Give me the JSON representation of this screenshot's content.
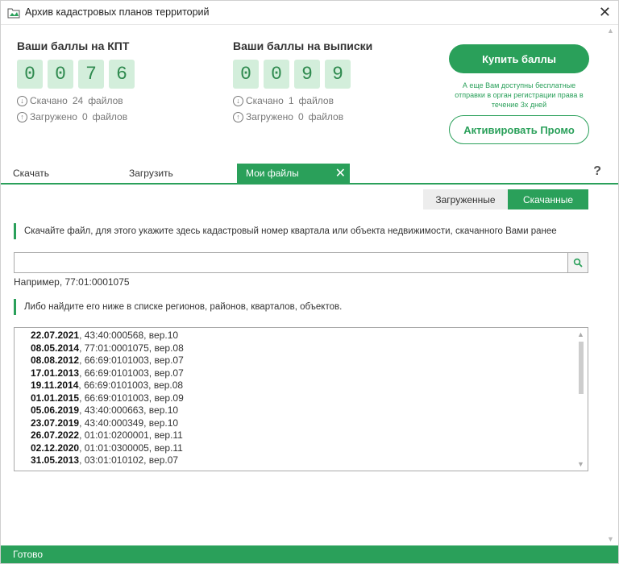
{
  "window": {
    "title": "Архив кадастровых планов территорий"
  },
  "kpt": {
    "title": "Ваши баллы на КПТ",
    "digits": [
      "0",
      "0",
      "7",
      "6"
    ],
    "downloaded_label": "Скачано",
    "downloaded_count": "24",
    "downloaded_unit": "файлов",
    "uploaded_label": "Загружено",
    "uploaded_count": "0",
    "uploaded_unit": "файлов"
  },
  "extracts": {
    "title": "Ваши баллы на выписки",
    "digits": [
      "0",
      "0",
      "9",
      "9"
    ],
    "downloaded_label": "Скачано",
    "downloaded_count": "1",
    "downloaded_unit": "файлов",
    "uploaded_label": "Загружено",
    "uploaded_count": "0",
    "uploaded_unit": "файлов"
  },
  "actions": {
    "buy_label": "Купить баллы",
    "promo_note": "А еще Вам доступны бесплатные отправки в орган регистрации права в течение 3х дней",
    "promo_label": "Активировать Промо"
  },
  "tabs": {
    "download": "Скачать",
    "upload": "Загрузить",
    "my_files": "Мои файлы",
    "help": "?"
  },
  "filter": {
    "uploaded": "Загруженные",
    "downloaded": "Скачанные"
  },
  "hint1": "Скачайте файл, для этого укажите здесь кадастровый номер квартала или объекта недвижимости, скачанного Вами ранее",
  "search": {
    "value": "",
    "example": "Например, 77:01:0001075"
  },
  "hint2": "Либо найдите его ниже в списке регионов, районов, кварталов, объектов.",
  "files": [
    {
      "date": "22.07.2021",
      "rest": ", 43:40:000568, вер.10"
    },
    {
      "date": "08.05.2014",
      "rest": ", 77:01:0001075, вер.08"
    },
    {
      "date": "08.08.2012",
      "rest": ", 66:69:0101003, вер.07"
    },
    {
      "date": "17.01.2013",
      "rest": ", 66:69:0101003, вер.07"
    },
    {
      "date": "19.11.2014",
      "rest": ", 66:69:0101003, вер.08"
    },
    {
      "date": "01.01.2015",
      "rest": ", 66:69:0101003, вер.09"
    },
    {
      "date": "05.06.2019",
      "rest": ", 43:40:000663, вер.10"
    },
    {
      "date": "23.07.2019",
      "rest": ", 43:40:000349, вер.10"
    },
    {
      "date": "26.07.2022",
      "rest": ", 01:01:0200001, вер.11"
    },
    {
      "date": "02.12.2020",
      "rest": ", 01:01:0300005, вер.11"
    },
    {
      "date": "31.05.2013",
      "rest": ", 03:01:010102, вер.07"
    }
  ],
  "status": "Готово",
  "colors": {
    "accent": "#2aa05a",
    "digit_bg": "#d3eedb",
    "digit_text": "#2f8a4f"
  }
}
